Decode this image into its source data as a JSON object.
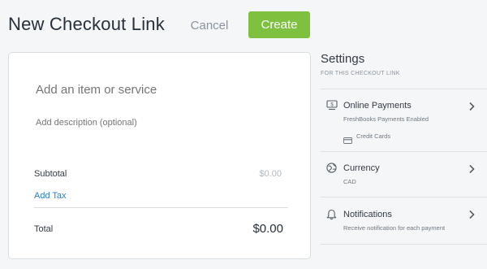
{
  "header": {
    "title": "New Checkout Link",
    "cancel_label": "Cancel",
    "create_label": "Create"
  },
  "colors": {
    "accent_green": "#7dc13f",
    "link_blue": "#2b7bc8",
    "background": "#f5f6f8"
  },
  "item": {
    "name_placeholder": "Add an item or service",
    "description_placeholder": "Add description (optional)"
  },
  "totals": {
    "subtotal_label": "Subtotal",
    "subtotal_value": "$0.00",
    "add_tax_label": "Add Tax",
    "total_label": "Total",
    "total_value": "$0.00"
  },
  "settings": {
    "title": "Settings",
    "subtitle": "FOR THIS CHECKOUT LINK",
    "rows": [
      {
        "icon": "online-payment-icon",
        "title": "Online Payments",
        "subtitle": "FreshBooks Payments Enabled",
        "detail_icon": "credit-card-icon",
        "detail_label": "Credit Cards"
      },
      {
        "icon": "globe-icon",
        "title": "Currency",
        "subtitle": "CAD"
      },
      {
        "icon": "bell-icon",
        "title": "Notifications",
        "subtitle": "Receive notification for each payment"
      }
    ]
  }
}
